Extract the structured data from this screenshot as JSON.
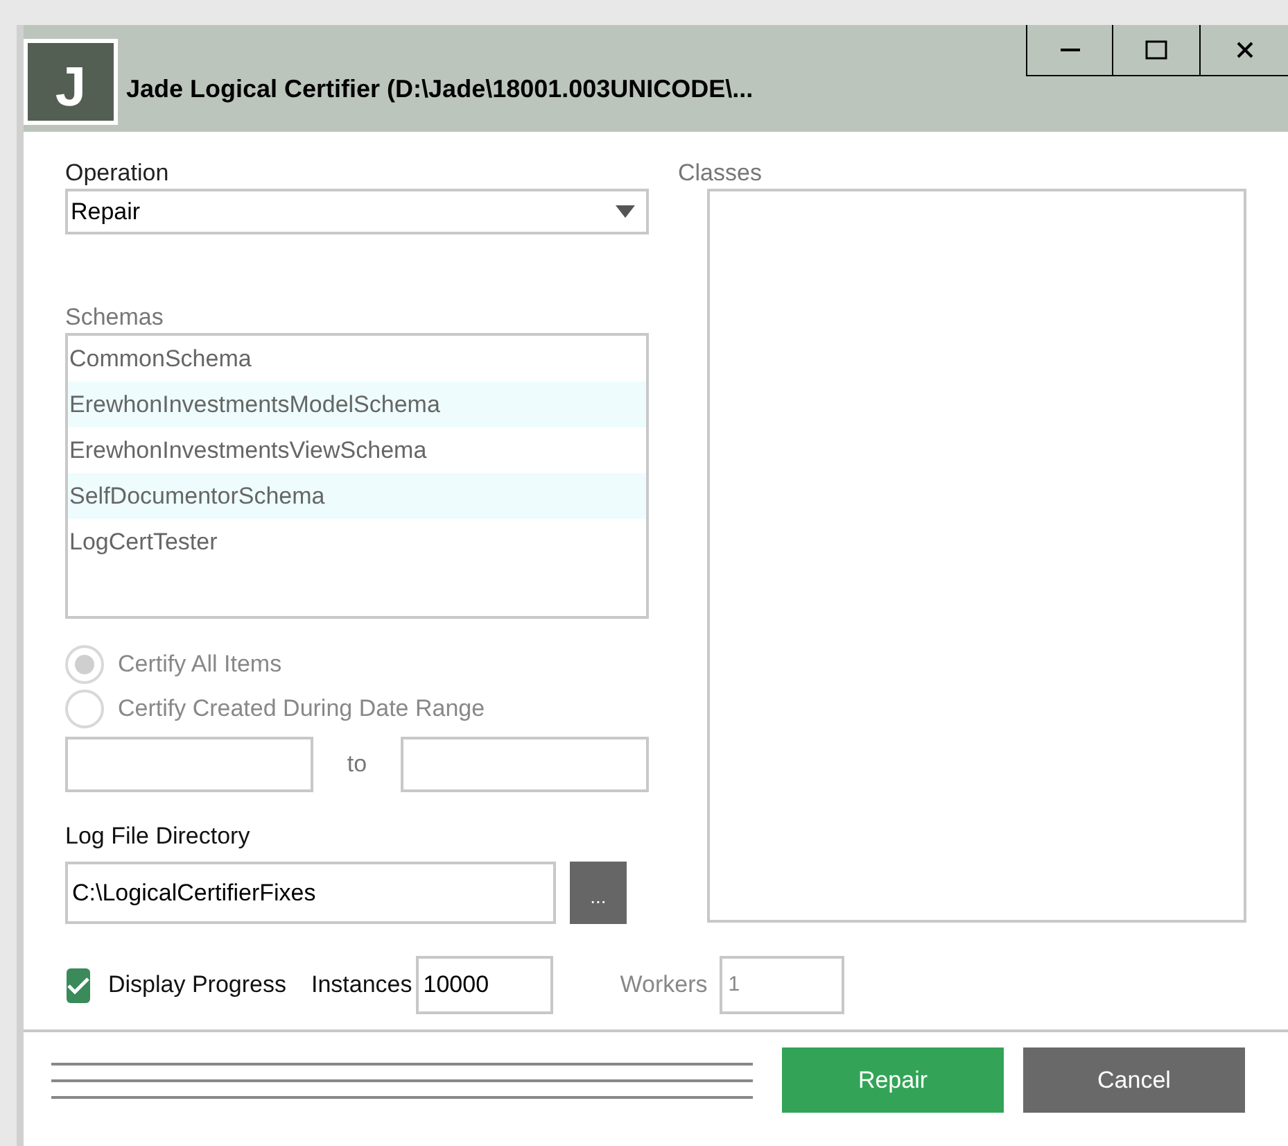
{
  "window": {
    "title": "Jade Logical Certifier (D:\\Jade\\18001.003UNICODE\\...",
    "icon_letter": "J"
  },
  "operation": {
    "label": "Operation",
    "value": "Repair"
  },
  "schemas": {
    "label": "Schemas",
    "items": [
      {
        "name": "CommonSchema"
      },
      {
        "name": "ErewhonInvestmentsModelSchema"
      },
      {
        "name": "ErewhonInvestmentsViewSchema"
      },
      {
        "name": "SelfDocumentorSchema"
      },
      {
        "name": "LogCertTester"
      }
    ]
  },
  "certify_options": [
    {
      "label": "Certify All Items",
      "selected": true,
      "disabled": true
    },
    {
      "label": "Certify Created During Date Range",
      "selected": false,
      "disabled": true
    }
  ],
  "date_range": {
    "separator": "to"
  },
  "log_directory": {
    "label": "Log File Directory",
    "value": "C:\\LogicalCertifierFixes",
    "browse_label": "..."
  },
  "classes": {
    "label": "Classes"
  },
  "display_progress": {
    "label": "Display Progress",
    "checked": true
  },
  "instances": {
    "label": "Instances",
    "value": "10000",
    "disabled": false
  },
  "workers": {
    "label": "Workers",
    "value": "1",
    "disabled": true
  },
  "buttons": [
    {
      "label": "Repair",
      "kind": "primary"
    },
    {
      "label": "Cancel",
      "kind": "secondary"
    }
  ]
}
